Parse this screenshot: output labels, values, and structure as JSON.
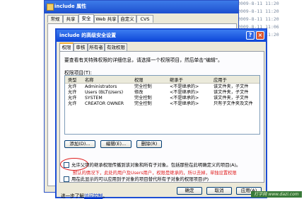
{
  "background_times": [
    "2009-8-11 11:20",
    "2009-8-11 11:20",
    "2009-8-11 11:20",
    "2009-8-11 11:06",
    "2009-8-11 11:20"
  ],
  "back_window": {
    "title": "include 属性",
    "tabs": [
      "常规",
      "共享",
      "安全",
      "Web 共享",
      "自定义",
      "CVS"
    ]
  },
  "dialog": {
    "title": "include 的高级安全设置",
    "help_glyph": "?",
    "close_glyph": "×",
    "tabs": [
      "权限",
      "审核",
      "所有者",
      "有效权限"
    ],
    "intro": "要查看有关特殊权限的详细信息，请选择一个权限项目，然后单击\"编辑\"。",
    "perm_items_label": "权限项目(T):",
    "columns": [
      "类型",
      "名称",
      "权限",
      "继承于",
      "应用于"
    ],
    "rows": [
      [
        "允许",
        "Administrators",
        "完全控制",
        "<不是继承的>",
        "该文件夹，子文件"
      ],
      [
        "允许",
        "Users (BLT\\Users)",
        "修改",
        "<不是继承的>",
        "该文件夹，子文件"
      ],
      [
        "允许",
        "SYSTEM",
        "完全控制",
        "<不是继承的>",
        "该文件夹，子文件"
      ],
      [
        "允许",
        "CREATOR OWNER",
        "完全控制",
        "<不是继承的>",
        "只有子文件夹及文件"
      ]
    ],
    "buttons": {
      "add": "添加(D)...",
      "edit": "编辑(E)...",
      "remove": "删除(R)"
    },
    "checkbox_inherit": "允许父项的继承权限传播到该对象和所有子对象。包括那些在此明确定义的项目(A)。",
    "annotation": "默认的情况下，此处的用户及Users用户，权限是继承的，所以去掉，单独设置权限",
    "checkbox_replace": "用在此显示的可以应用到子对象的项目替代所有子对象的权限项目(P)",
    "learn_more_prefix": "进一步了解",
    "learn_more_link": "访问控制",
    "learn_more_suffix": "。",
    "footer_buttons": {
      "ok": "确定",
      "cancel": "取消",
      "apply": "应用(A)"
    }
  },
  "watermark": "打字网 www.dazi.com"
}
